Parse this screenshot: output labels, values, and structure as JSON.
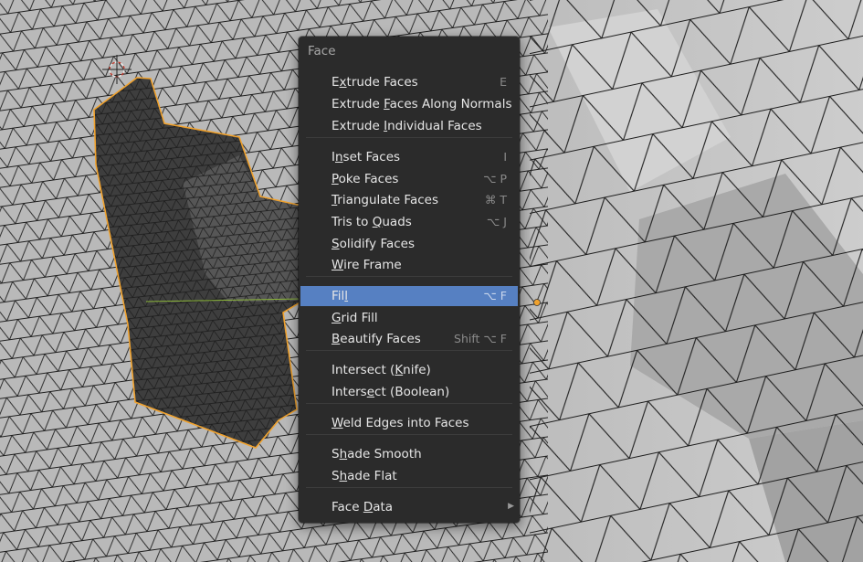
{
  "menu": {
    "title": "Face",
    "items": [
      {
        "label": "Extrude Faces",
        "underline": 1,
        "shortcut": "E"
      },
      {
        "label": "Extrude Faces Along Normals",
        "underline": 8,
        "shortcut": ""
      },
      {
        "label": "Extrude Individual Faces",
        "underline": 8,
        "shortcut": ""
      },
      {
        "label": "Inset Faces",
        "underline": 1,
        "shortcut": "I"
      },
      {
        "label": "Poke Faces",
        "underline": 0,
        "shortcut": "⌥ P"
      },
      {
        "label": "Triangulate Faces",
        "underline": 0,
        "shortcut": "⌘ T"
      },
      {
        "label": "Tris to Quads",
        "underline": 8,
        "shortcut": "⌥ J"
      },
      {
        "label": "Solidify Faces",
        "underline": 0,
        "shortcut": ""
      },
      {
        "label": "Wire Frame",
        "underline": 0,
        "shortcut": ""
      },
      {
        "label": "Fill",
        "underline": 3,
        "shortcut": "⌥ F",
        "active": true
      },
      {
        "label": "Grid Fill",
        "underline": 0,
        "shortcut": ""
      },
      {
        "label": "Beautify Faces",
        "underline": 0,
        "shortcut": "Shift ⌥ F"
      },
      {
        "label": "Intersect (Knife)",
        "underline": 11,
        "shortcut": ""
      },
      {
        "label": "Intersect (Boolean)",
        "underline": 6,
        "shortcut": ""
      },
      {
        "label": "Weld Edges into Faces",
        "underline": 0,
        "shortcut": ""
      },
      {
        "label": "Shade Smooth",
        "underline": 1,
        "shortcut": ""
      },
      {
        "label": "Shade Flat",
        "underline": 1,
        "shortcut": ""
      },
      {
        "label": "Face Data",
        "underline": 5,
        "shortcut": "",
        "submenu": true
      }
    ]
  },
  "colors": {
    "menu_bg": "#2b2b2b",
    "highlight": "#5680c2",
    "selection_outline": "#f0a22e",
    "mesh_wire": "#1e1e1e",
    "mesh_face": "#b8b8b8"
  }
}
